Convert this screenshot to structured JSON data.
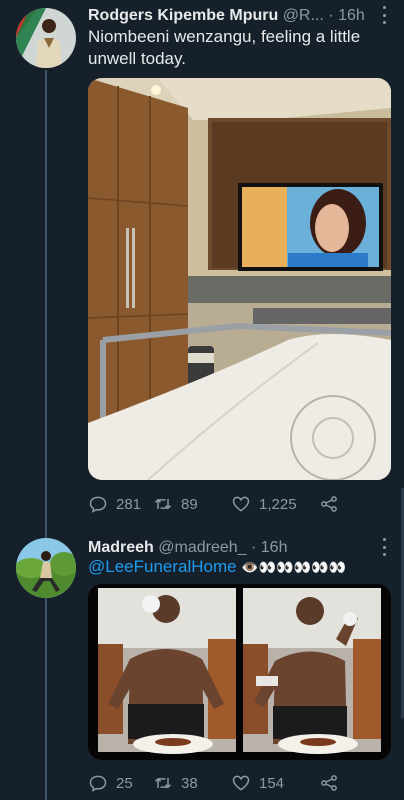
{
  "tweets": [
    {
      "name": "Rodgers Kipembe Mpuru",
      "handle": "@R...",
      "separator": "·",
      "time": "16h",
      "text": "Niombeeni wenzangu, feeling a little unwell today.",
      "stats": {
        "replies": "281",
        "retweets": "89",
        "likes": "1,225"
      }
    },
    {
      "name": "Madreeh",
      "handle": "@madreeh_",
      "separator": "·",
      "time": "16h",
      "mention": "@LeeFuneralHome",
      "emoji": "👁️👀👀👀👀👀",
      "stats": {
        "replies": "25",
        "retweets": "38",
        "likes": "154"
      }
    }
  ],
  "icons": [
    "reply-icon",
    "retweet-icon",
    "like-icon",
    "share-icon",
    "more-icon"
  ],
  "colors": {
    "background": "#15202b",
    "accent": "#1d9bf0",
    "muted": "#8b98a5",
    "text": "#e7e9ea"
  }
}
